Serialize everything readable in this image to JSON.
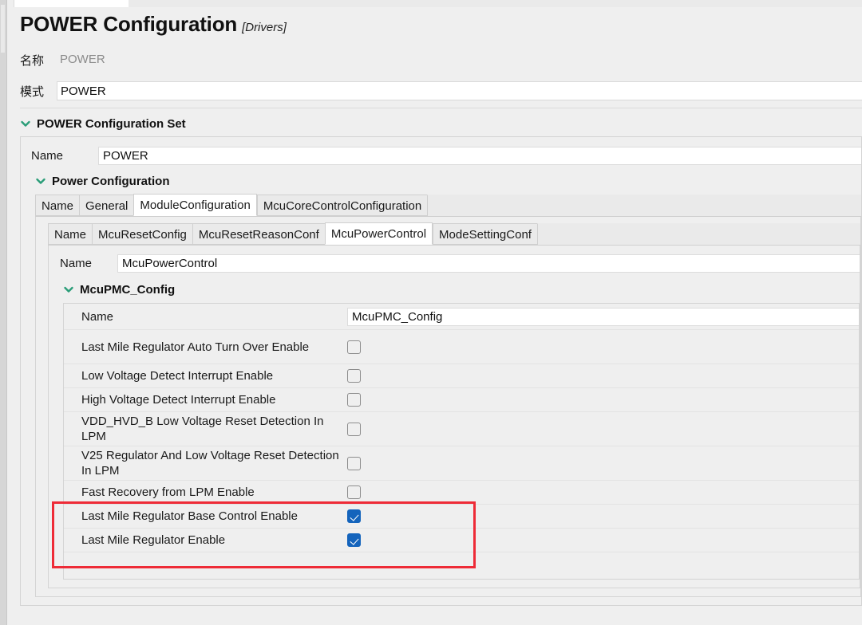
{
  "window": {
    "title": "POWER Configuration",
    "title_suffix": "[Drivers]"
  },
  "header": {
    "name_label": "名称",
    "name_value": "POWER",
    "mode_label": "模式",
    "mode_value": "POWER"
  },
  "config_set": {
    "section_label": "POWER Configuration Set",
    "name_label": "Name",
    "name_value": "POWER"
  },
  "power_configuration": {
    "section_label": "Power Configuration",
    "tabs": [
      {
        "label": "Name",
        "active": false
      },
      {
        "label": "General",
        "active": false
      },
      {
        "label": "ModuleConfiguration",
        "active": true
      },
      {
        "label": "McuCoreControlConfiguration",
        "active": false
      }
    ]
  },
  "module_configuration": {
    "tabs": [
      {
        "label": "Name",
        "active": false
      },
      {
        "label": "McuResetConfig",
        "active": false
      },
      {
        "label": "McuResetReasonConf",
        "active": false
      },
      {
        "label": "McuPowerControl",
        "active": true
      },
      {
        "label": "ModeSettingConf",
        "active": false
      }
    ],
    "name_label": "Name",
    "name_value": "McuPowerControl"
  },
  "mcu_pmc_config": {
    "section_label": "McuPMC_Config",
    "name_label": "Name",
    "name_value": "McuPMC_Config",
    "properties": [
      {
        "label": "Last Mile Regulator Auto Turn Over Enable",
        "checked": false,
        "highlighted": false
      },
      {
        "label": "Low Voltage Detect Interrupt Enable",
        "checked": false,
        "highlighted": false
      },
      {
        "label": "High Voltage Detect Interrupt Enable",
        "checked": false,
        "highlighted": false
      },
      {
        "label": "VDD_HVD_B Low Voltage Reset Detection In LPM",
        "checked": false,
        "highlighted": false
      },
      {
        "label": "V25 Regulator And Low Voltage Reset Detection In LPM",
        "checked": false,
        "highlighted": false
      },
      {
        "label": "Fast Recovery from LPM Enable",
        "checked": false,
        "highlighted": false
      },
      {
        "label": "Last Mile Regulator Base Control Enable",
        "checked": true,
        "highlighted": true
      },
      {
        "label": "Last Mile Regulator Enable",
        "checked": true,
        "highlighted": true
      }
    ]
  },
  "icons": {
    "collapse_chevron": "chevron-down-icon"
  },
  "colors": {
    "checkbox_checked": "#1464bc",
    "annotation_box": "#ee2b37",
    "chevron": "#2a9d78",
    "panel_background": "#efefef",
    "field_background": "#ffffff"
  }
}
